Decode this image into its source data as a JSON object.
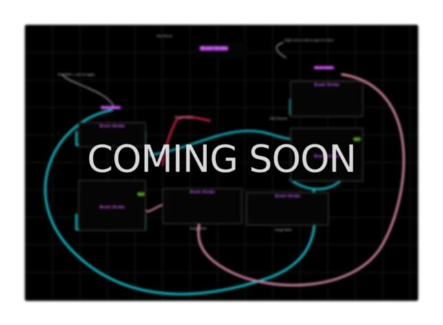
{
  "overlay": {
    "text": "COMING SOON"
  },
  "colors": {
    "canvas_bg": "#000000",
    "wire_cyan": "#18b7c4",
    "wire_pink": "#d78aa6",
    "wire_red": "#b21d3c",
    "node_title": "#d25cff",
    "node_teal": "#19b1b6",
    "accent_green": "#76c22a",
    "accent_purple": "#9b2ac8"
  },
  "nodes": [
    {
      "id": "n_top_center",
      "title": "Brush Stroke",
      "caption": "Rasterize",
      "icon": "node-icon"
    },
    {
      "id": "n_left_upper",
      "title": "Brush Stroke",
      "caption": "",
      "icon": "node-icon"
    },
    {
      "id": "n_left_lower",
      "title": "Brush Stroke",
      "caption": "",
      "icon": "node-icon"
    },
    {
      "id": "n_center_bottom",
      "title": "Brush Stroke",
      "caption": "Image Node",
      "icon": "node-icon"
    },
    {
      "id": "n_right_bottom",
      "title": "Brush Stroke",
      "caption": "Image Node",
      "icon": "node-icon"
    },
    {
      "id": "n_right_upper",
      "title": "Brush Stroke",
      "caption": "",
      "icon": "node-icon"
    },
    {
      "id": "n_right_mid",
      "title": "Brush Stroke",
      "caption": "",
      "icon": "node-icon"
    }
  ],
  "labels": {
    "top_caption": "Paint Brush",
    "left_note": "Hold Shift + click to toggle",
    "right_note": "Right-click a node to open its menu",
    "mid_label": "Merge Layers",
    "right_mid_label": "Add Channel"
  }
}
